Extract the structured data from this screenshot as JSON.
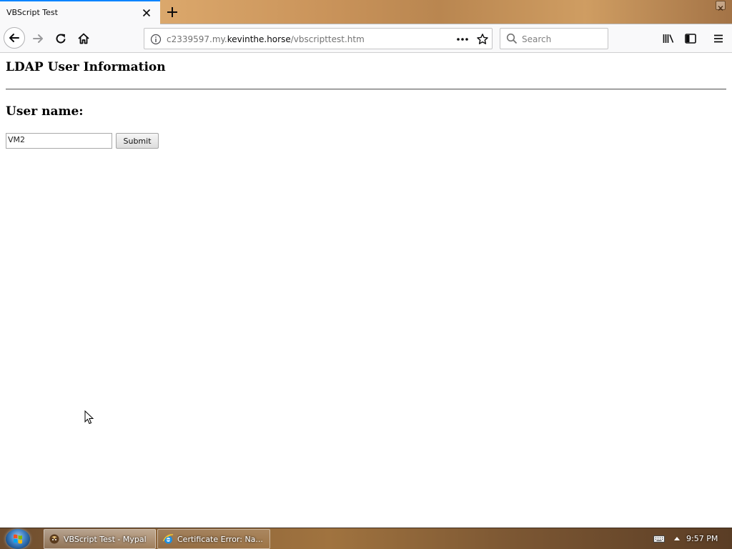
{
  "browser": {
    "tab": {
      "title": "VBScript Test"
    },
    "url": {
      "prefix": "c2339597.my.",
      "domain": "kevinthe.horse",
      "path": "/vbscripttest.htm"
    },
    "search": {
      "placeholder": "Search"
    },
    "accent_color": "#0a84ff"
  },
  "page": {
    "heading": "LDAP User Information",
    "user_label": "User name:",
    "user_value": "VM2",
    "submit_label": "Submit"
  },
  "taskbar": {
    "buttons": [
      {
        "label": "VBScript Test - Mypal",
        "icon": "mypal-icon"
      },
      {
        "label": "Certificate Error: Na...",
        "icon": "ie-icon"
      }
    ],
    "clock": "9:57 PM"
  }
}
